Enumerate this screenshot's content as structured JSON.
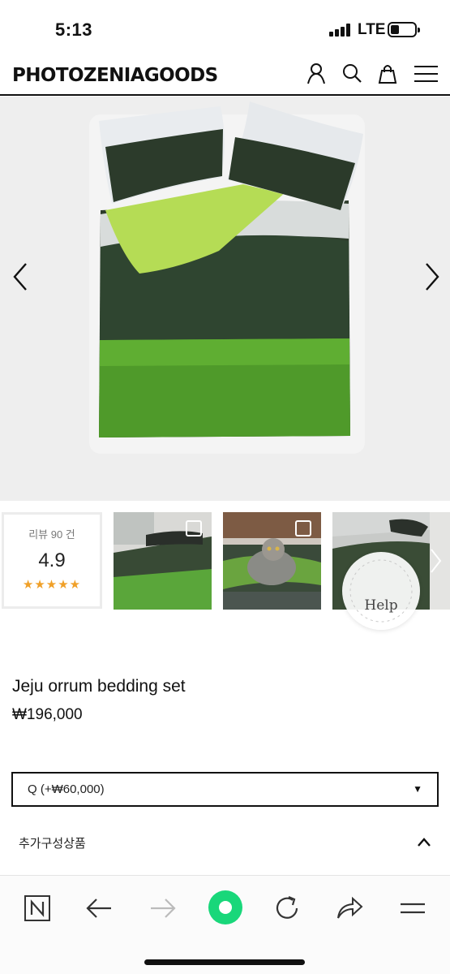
{
  "status_bar": {
    "time": "5:13",
    "network": "LTE"
  },
  "header": {
    "brand": "PHOTOZENIAGOODS",
    "icons": [
      "user-icon",
      "search-icon",
      "bag-icon",
      "menu-icon"
    ]
  },
  "gallery": {
    "prev_icon": "chevron-left-icon",
    "next_icon": "chevron-right-icon"
  },
  "reviews": {
    "count_text": "리뷰 90 건",
    "score": "4.9",
    "stars": "★★★★★",
    "star_color": "#f0a028"
  },
  "help_badge": {
    "label": "Help"
  },
  "product": {
    "name": "Jeju orrum bedding set",
    "price": "₩196,000"
  },
  "option": {
    "selected": "Q (+₩60,000)",
    "caret": "▼"
  },
  "extra_options": {
    "label": "추가구성상품"
  },
  "browser_bar": {
    "icons": [
      "naver-n-icon",
      "back-arrow-icon",
      "forward-arrow-icon",
      "green-dot-home-icon",
      "reload-icon",
      "share-icon",
      "menu-lines-icon"
    ],
    "accent": "#19d77a"
  }
}
